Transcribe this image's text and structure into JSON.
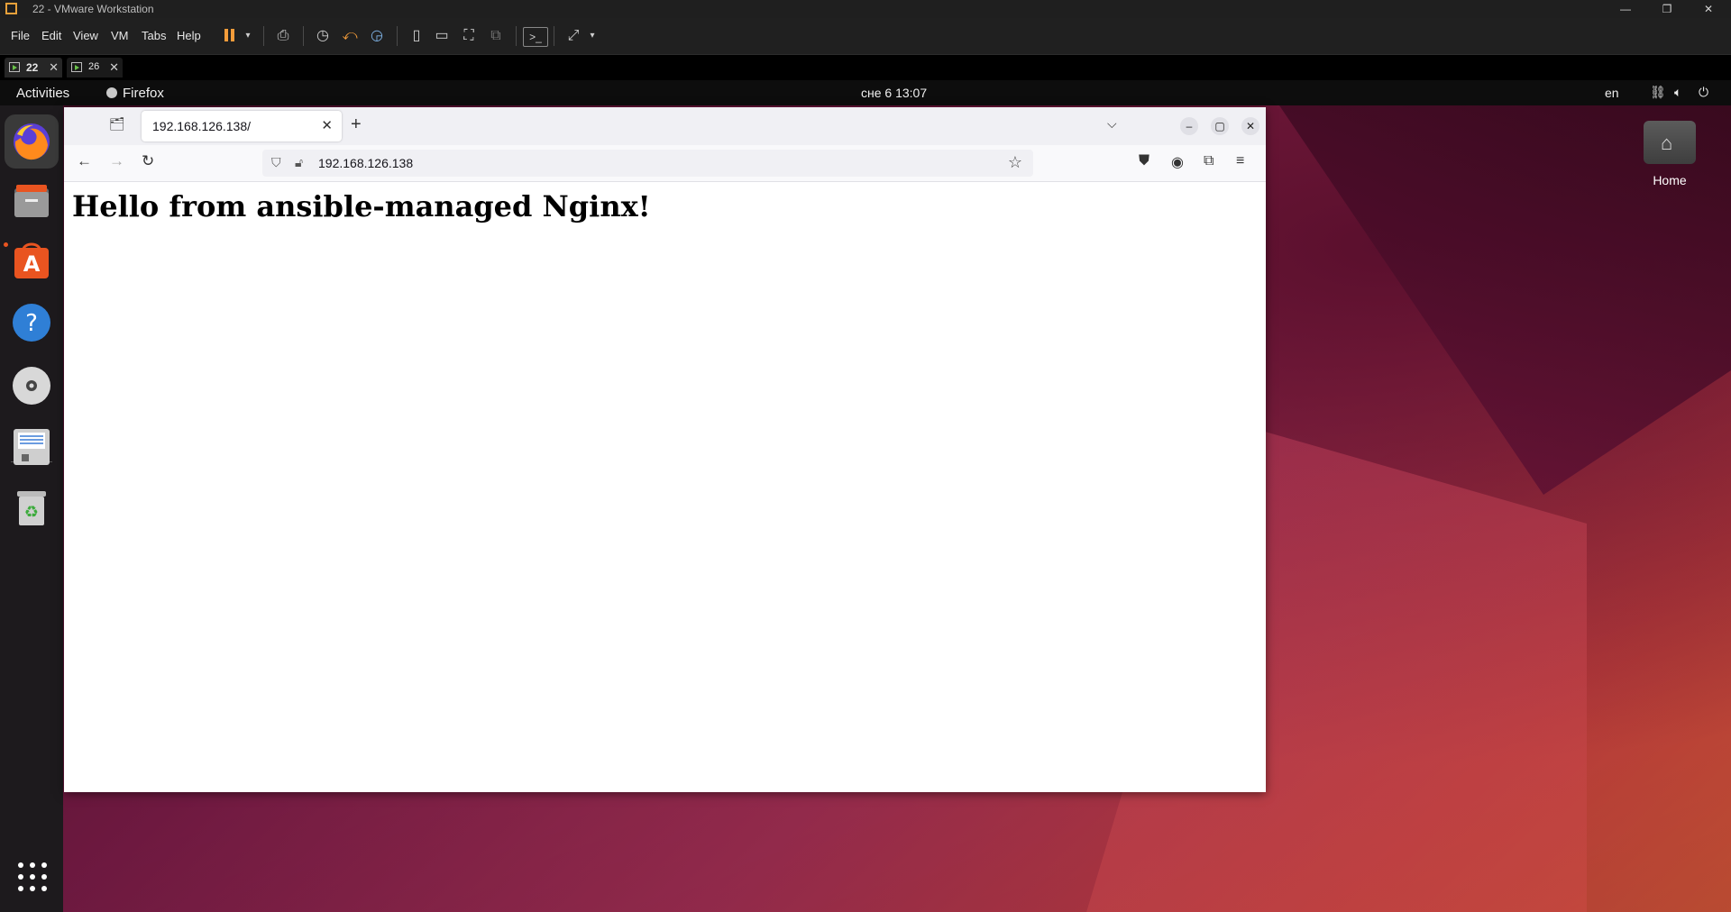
{
  "vmware": {
    "window_title": "22 - VMware Workstation",
    "menu": [
      "File",
      "Edit",
      "View",
      "VM",
      "Tabs",
      "Help"
    ],
    "tabs": [
      {
        "label": "22",
        "active": true
      },
      {
        "label": "26",
        "active": false
      }
    ],
    "accent_color": "#f39c3a"
  },
  "ubuntu": {
    "activities": "Activities",
    "app_name": "Firefox",
    "clock": "сне 6  13:07",
    "language": "en",
    "desktop_icon_label": "Home",
    "dock_apps": [
      "firefox-icon",
      "files-icon",
      "app-center-icon",
      "help-icon",
      "dvd-icon",
      "save-icon",
      "trash-icon"
    ]
  },
  "firefox": {
    "tab_title": "192.168.126.138/",
    "url": "192.168.126.138",
    "page_heading": "Hello from ansible-managed Nginx!"
  }
}
